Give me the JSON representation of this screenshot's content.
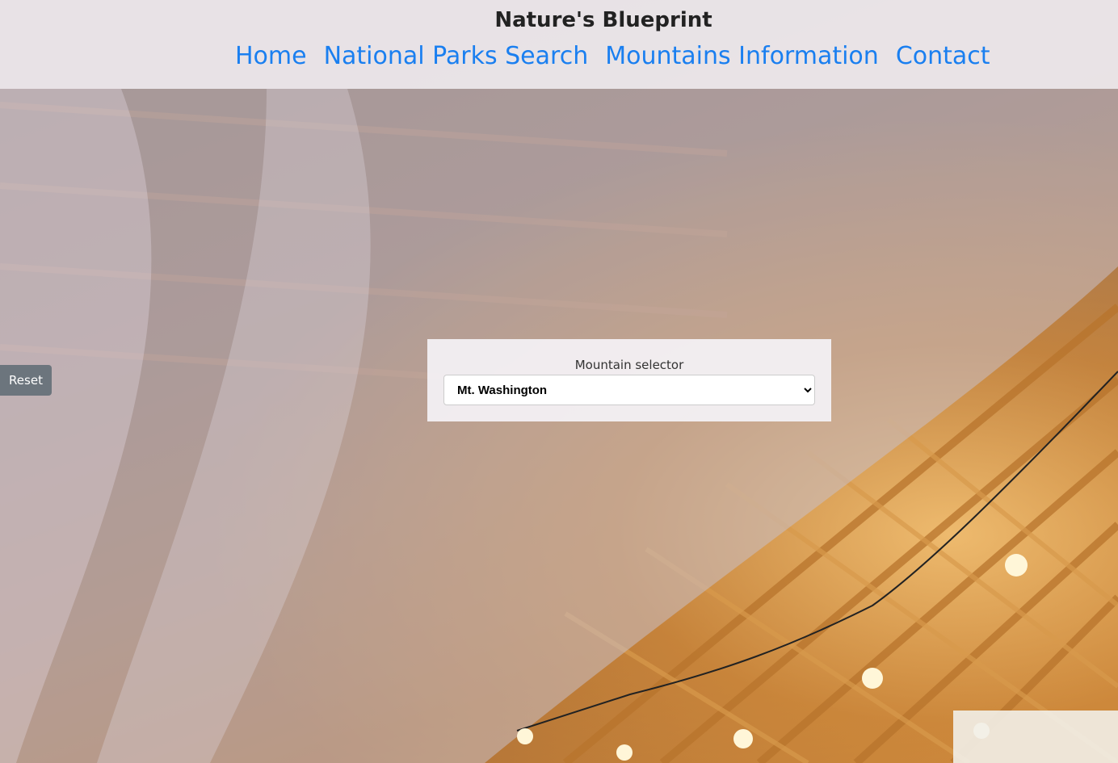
{
  "header": {
    "site_title": "Nature's Blueprint",
    "nav": [
      {
        "label": "Home"
      },
      {
        "label": "National Parks Search"
      },
      {
        "label": "Mountains Information"
      },
      {
        "label": "Contact"
      }
    ]
  },
  "controls": {
    "reset_label": "Reset"
  },
  "selector": {
    "label": "Mountain selector",
    "selected_value": "Mt. Washington"
  },
  "colors": {
    "nav_link": "#1a7ff0",
    "header_bg": "#f0ecf0",
    "reset_bg": "#6c757d"
  },
  "icons": {
    "select_arrow": "chevron-down-icon"
  }
}
